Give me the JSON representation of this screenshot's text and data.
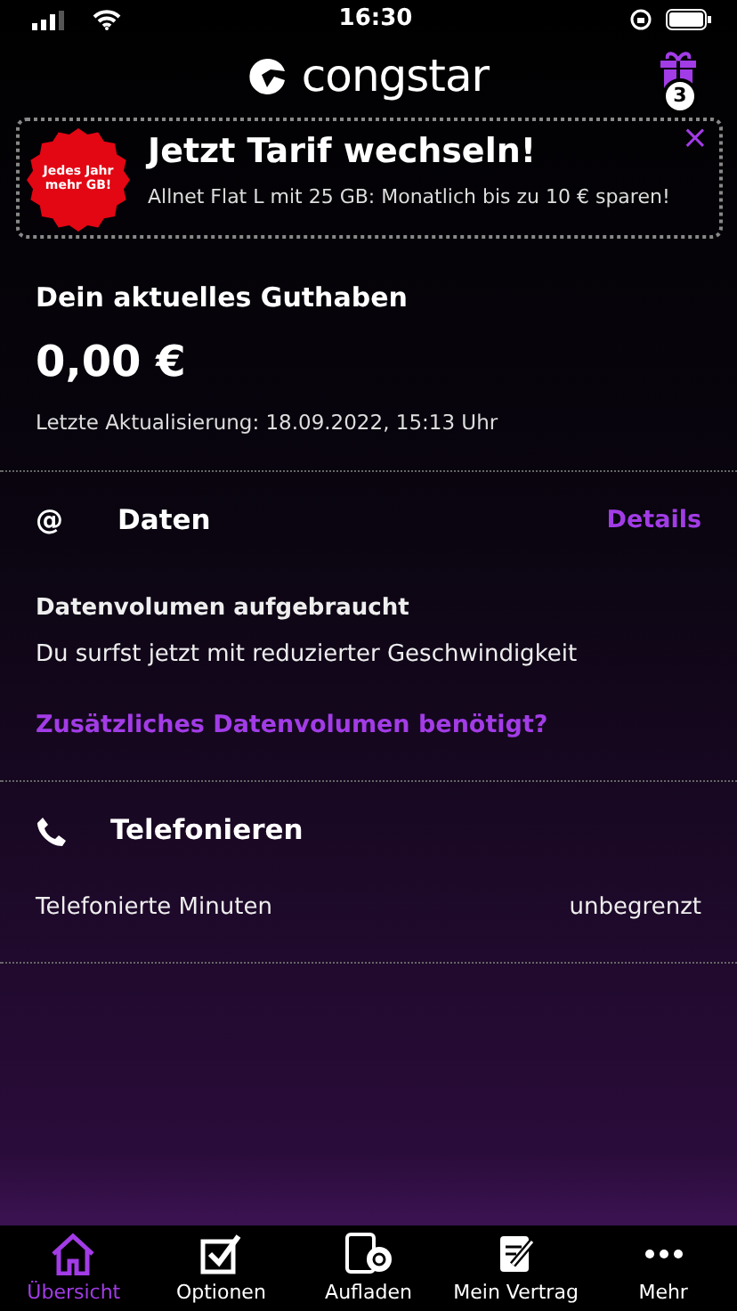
{
  "status_bar": {
    "time": "16:30"
  },
  "header": {
    "logo": "congstar",
    "gift_count": "3"
  },
  "promo": {
    "badge": "Jedes Jahr mehr GB!",
    "title": "Jetzt Tarif wechseln!",
    "text": "Allnet Flat L mit 25 GB: Monatlich bis zu 10 € sparen!",
    "close": "×"
  },
  "balance": {
    "label": "Dein aktuelles Guthaben",
    "amount": "0,00 €",
    "updated": "Letzte Aktualisierung: 18.09.2022, 15:13 Uhr"
  },
  "sections": [
    {
      "kind": "data",
      "icon": "@",
      "title": "Daten",
      "link": "Details",
      "heading": "Datenvolumen aufgebraucht",
      "text": "Du surfst jetzt mit reduzierter Geschwindigkeit",
      "action": "Zusätzliches Datenvolumen benötigt?"
    },
    {
      "kind": "phone",
      "title": "Telefonieren",
      "rows": [
        {
          "label": "Telefonierte Minuten",
          "value": "unbegrenzt"
        }
      ]
    }
  ],
  "tabs": [
    {
      "kind": "home",
      "label": "Übersicht",
      "selected": true
    },
    {
      "kind": "check",
      "label": "Optionen",
      "selected": false
    },
    {
      "kind": "topup",
      "label": "Aufladen",
      "selected": false
    },
    {
      "kind": "contract",
      "label": "Mein Vertrag",
      "selected": false
    },
    {
      "kind": "more",
      "label": "Mehr",
      "selected": false
    }
  ]
}
